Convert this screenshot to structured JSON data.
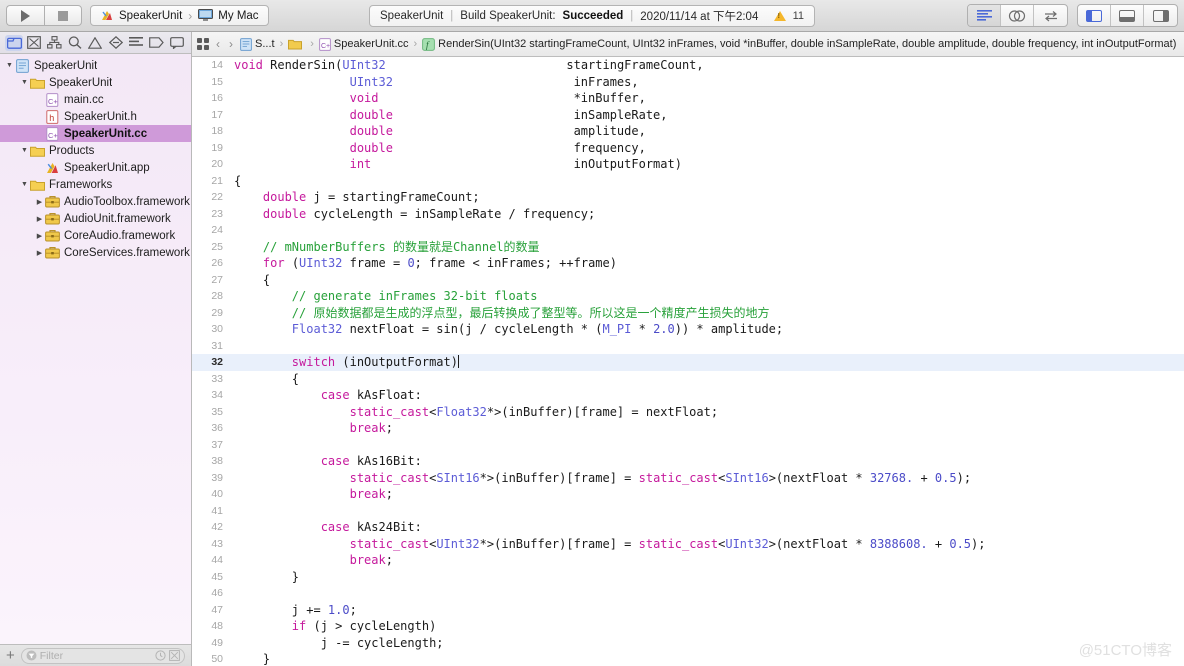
{
  "window": {
    "title": "SpeakerUnit",
    "watermark": "@51CTO博客"
  },
  "toolbar": {
    "run_button": "Run",
    "stop_button": "Stop",
    "scheme": {
      "target": "SpeakerUnit",
      "separator": "›",
      "destination": "My Mac"
    },
    "status": {
      "project": "SpeakerUnit",
      "sep1": "|",
      "action": "Build SpeakerUnit:",
      "result": "Succeeded",
      "sep2": "|",
      "timestamp": "2020/11/14 at 下午2:04",
      "warning_count": "11"
    },
    "editor_modes": [
      {
        "name": "standard-editor",
        "icon": "lines-icon",
        "active": true
      },
      {
        "name": "assistant-editor",
        "icon": "venn-icon",
        "active": false
      },
      {
        "name": "version-editor",
        "icon": "swap-arrows-icon",
        "active": false
      }
    ],
    "panel_toggles": [
      {
        "name": "navigator-toggle",
        "icon": "panel-left-icon",
        "active": true
      },
      {
        "name": "debug-area-toggle",
        "icon": "panel-bottom-icon",
        "active": false
      },
      {
        "name": "utilities-toggle",
        "icon": "panel-right-icon",
        "active": false
      }
    ]
  },
  "navigator": {
    "tabs": [
      {
        "name": "project-navigator",
        "icon": "folder-icon",
        "selected": true
      },
      {
        "name": "source-control-navigator",
        "icon": "source-control-icon",
        "selected": false
      },
      {
        "name": "symbol-navigator",
        "icon": "hierarchy-icon",
        "selected": false
      },
      {
        "name": "find-navigator",
        "icon": "search-icon",
        "selected": false
      },
      {
        "name": "issue-navigator",
        "icon": "warning-triangle-icon",
        "selected": false
      },
      {
        "name": "test-navigator",
        "icon": "diamond-icon",
        "selected": false
      },
      {
        "name": "debug-navigator",
        "icon": "debug-gauge-icon",
        "selected": false
      },
      {
        "name": "breakpoint-navigator",
        "icon": "breakpoint-tag-icon",
        "selected": false
      },
      {
        "name": "report-navigator",
        "icon": "speech-bubble-icon",
        "selected": false
      }
    ],
    "tree": [
      {
        "label": "SpeakerUnit",
        "depth": 0,
        "icon": "project-icon",
        "disclosure": "open",
        "selected": false
      },
      {
        "label": "SpeakerUnit",
        "depth": 1,
        "icon": "folder-icon",
        "disclosure": "open",
        "selected": false
      },
      {
        "label": "main.cc",
        "depth": 2,
        "icon": "cc-file-icon",
        "disclosure": "none",
        "selected": false
      },
      {
        "label": "SpeakerUnit.h",
        "depth": 2,
        "icon": "h-file-icon",
        "disclosure": "none",
        "selected": false
      },
      {
        "label": "SpeakerUnit.cc",
        "depth": 2,
        "icon": "cc-file-icon",
        "disclosure": "none",
        "selected": true
      },
      {
        "label": "Products",
        "depth": 1,
        "icon": "folder-icon",
        "disclosure": "open",
        "selected": false
      },
      {
        "label": "SpeakerUnit.app",
        "depth": 2,
        "icon": "app-icon",
        "disclosure": "none",
        "selected": false
      },
      {
        "label": "Frameworks",
        "depth": 1,
        "icon": "folder-icon",
        "disclosure": "open",
        "selected": false
      },
      {
        "label": "AudioToolbox.framework",
        "depth": 2,
        "icon": "framework-icon",
        "disclosure": "closed",
        "selected": false
      },
      {
        "label": "AudioUnit.framework",
        "depth": 2,
        "icon": "framework-icon",
        "disclosure": "closed",
        "selected": false
      },
      {
        "label": "CoreAudio.framework",
        "depth": 2,
        "icon": "framework-icon",
        "disclosure": "closed",
        "selected": false
      },
      {
        "label": "CoreServices.framework",
        "depth": 2,
        "icon": "framework-icon",
        "disclosure": "closed",
        "selected": false
      }
    ],
    "filter": {
      "add_label": "+",
      "placeholder": "Filter",
      "recent_icon": "clock-icon",
      "sourcecontrol_icon": "source-control-filter-icon"
    }
  },
  "jumpbar": {
    "related_items": "related-items-icon",
    "back": "‹",
    "forward": "›",
    "crumbs": [
      {
        "label": "S...t",
        "icon": "project-icon"
      },
      {
        "label": "",
        "icon": "folder-icon"
      },
      {
        "label": "SpeakerUnit.cc",
        "icon": "cc-file-icon"
      },
      {
        "label": "RenderSin(UInt32 startingFrameCount, UInt32 inFrames, void *inBuffer, double inSampleRate, double amplitude, double frequency, int inOutputFormat)",
        "icon": "function-icon"
      }
    ],
    "prev_issue": "‹",
    "next_issue": "›",
    "issue_icon": "warning-triangle-icon"
  },
  "code": {
    "current_line": 32,
    "lines": [
      {
        "n": 14,
        "tokens": [
          {
            "t": "void",
            "c": "kw"
          },
          {
            "t": " RenderSin(",
            "c": "plain"
          },
          {
            "t": "UInt32",
            "c": "typ"
          },
          {
            "t": "                         startingFrameCount,",
            "c": "plain"
          }
        ]
      },
      {
        "n": 15,
        "tokens": [
          {
            "t": "                ",
            "c": "plain"
          },
          {
            "t": "UInt32",
            "c": "typ"
          },
          {
            "t": "                         inFrames,",
            "c": "plain"
          }
        ]
      },
      {
        "n": 16,
        "tokens": [
          {
            "t": "                ",
            "c": "plain"
          },
          {
            "t": "void",
            "c": "kw"
          },
          {
            "t": "                           *inBuffer,",
            "c": "plain"
          }
        ]
      },
      {
        "n": 17,
        "tokens": [
          {
            "t": "                ",
            "c": "plain"
          },
          {
            "t": "double",
            "c": "kw"
          },
          {
            "t": "                         inSampleRate,",
            "c": "plain"
          }
        ]
      },
      {
        "n": 18,
        "tokens": [
          {
            "t": "                ",
            "c": "plain"
          },
          {
            "t": "double",
            "c": "kw"
          },
          {
            "t": "                         amplitude,",
            "c": "plain"
          }
        ]
      },
      {
        "n": 19,
        "tokens": [
          {
            "t": "                ",
            "c": "plain"
          },
          {
            "t": "double",
            "c": "kw"
          },
          {
            "t": "                         frequency,",
            "c": "plain"
          }
        ]
      },
      {
        "n": 20,
        "tokens": [
          {
            "t": "                ",
            "c": "plain"
          },
          {
            "t": "int",
            "c": "kw"
          },
          {
            "t": "                            inOutputFormat)",
            "c": "plain"
          }
        ]
      },
      {
        "n": 21,
        "tokens": [
          {
            "t": "{",
            "c": "plain"
          }
        ]
      },
      {
        "n": 22,
        "tokens": [
          {
            "t": "    ",
            "c": "plain"
          },
          {
            "t": "double",
            "c": "kw"
          },
          {
            "t": " j = startingFrameCount;",
            "c": "plain"
          }
        ]
      },
      {
        "n": 23,
        "tokens": [
          {
            "t": "    ",
            "c": "plain"
          },
          {
            "t": "double",
            "c": "kw"
          },
          {
            "t": " cycleLength = inSampleRate / frequency;",
            "c": "plain"
          }
        ]
      },
      {
        "n": 24,
        "tokens": []
      },
      {
        "n": 25,
        "tokens": [
          {
            "t": "    ",
            "c": "plain"
          },
          {
            "t": "// mNumberBuffers 的数量就是Channel的数量",
            "c": "cmt"
          }
        ]
      },
      {
        "n": 26,
        "tokens": [
          {
            "t": "    ",
            "c": "plain"
          },
          {
            "t": "for",
            "c": "kw"
          },
          {
            "t": " (",
            "c": "plain"
          },
          {
            "t": "UInt32",
            "c": "typ"
          },
          {
            "t": " frame = ",
            "c": "plain"
          },
          {
            "t": "0",
            "c": "num"
          },
          {
            "t": "; frame < inFrames; ++frame)",
            "c": "plain"
          }
        ]
      },
      {
        "n": 27,
        "tokens": [
          {
            "t": "    {",
            "c": "plain"
          }
        ]
      },
      {
        "n": 28,
        "tokens": [
          {
            "t": "        ",
            "c": "plain"
          },
          {
            "t": "// generate inFrames 32-bit floats",
            "c": "cmt"
          }
        ]
      },
      {
        "n": 29,
        "tokens": [
          {
            "t": "        ",
            "c": "plain"
          },
          {
            "t": "// 原始数据都是生成的浮点型，最后转换成了整型等。所以这是一个精度产生损失的地方",
            "c": "cmt"
          }
        ]
      },
      {
        "n": 30,
        "tokens": [
          {
            "t": "        ",
            "c": "plain"
          },
          {
            "t": "Float32",
            "c": "typ"
          },
          {
            "t": " nextFloat = sin(j / cycleLength * (",
            "c": "plain"
          },
          {
            "t": "M_PI",
            "c": "mac"
          },
          {
            "t": " * ",
            "c": "plain"
          },
          {
            "t": "2.0",
            "c": "num"
          },
          {
            "t": ")) * amplitude;",
            "c": "plain"
          }
        ]
      },
      {
        "n": 31,
        "tokens": []
      },
      {
        "n": 32,
        "tokens": [
          {
            "t": "        ",
            "c": "plain"
          },
          {
            "t": "switch",
            "c": "kw"
          },
          {
            "t": " (inOutputFormat)",
            "c": "plain"
          }
        ],
        "caret": true
      },
      {
        "n": 33,
        "tokens": [
          {
            "t": "        {",
            "c": "plain"
          }
        ]
      },
      {
        "n": 34,
        "tokens": [
          {
            "t": "            ",
            "c": "plain"
          },
          {
            "t": "case",
            "c": "kw"
          },
          {
            "t": " kAsFloat:",
            "c": "plain"
          }
        ]
      },
      {
        "n": 35,
        "tokens": [
          {
            "t": "                ",
            "c": "plain"
          },
          {
            "t": "static_cast",
            "c": "kw"
          },
          {
            "t": "<",
            "c": "plain"
          },
          {
            "t": "Float32",
            "c": "typ"
          },
          {
            "t": "*>(inBuffer)[frame] = nextFloat;",
            "c": "plain"
          }
        ]
      },
      {
        "n": 36,
        "tokens": [
          {
            "t": "                ",
            "c": "plain"
          },
          {
            "t": "break",
            "c": "kw"
          },
          {
            "t": ";",
            "c": "plain"
          }
        ]
      },
      {
        "n": 37,
        "tokens": []
      },
      {
        "n": 38,
        "tokens": [
          {
            "t": "            ",
            "c": "plain"
          },
          {
            "t": "case",
            "c": "kw"
          },
          {
            "t": " kAs16Bit:",
            "c": "plain"
          }
        ]
      },
      {
        "n": 39,
        "tokens": [
          {
            "t": "                ",
            "c": "plain"
          },
          {
            "t": "static_cast",
            "c": "kw"
          },
          {
            "t": "<",
            "c": "plain"
          },
          {
            "t": "SInt16",
            "c": "typ"
          },
          {
            "t": "*>(inBuffer)[frame] = ",
            "c": "plain"
          },
          {
            "t": "static_cast",
            "c": "kw"
          },
          {
            "t": "<",
            "c": "plain"
          },
          {
            "t": "SInt16",
            "c": "typ"
          },
          {
            "t": ">(nextFloat * ",
            "c": "plain"
          },
          {
            "t": "32768.",
            "c": "num"
          },
          {
            "t": " + ",
            "c": "plain"
          },
          {
            "t": "0.5",
            "c": "num"
          },
          {
            "t": ");",
            "c": "plain"
          }
        ]
      },
      {
        "n": 40,
        "tokens": [
          {
            "t": "                ",
            "c": "plain"
          },
          {
            "t": "break",
            "c": "kw"
          },
          {
            "t": ";",
            "c": "plain"
          }
        ]
      },
      {
        "n": 41,
        "tokens": []
      },
      {
        "n": 42,
        "tokens": [
          {
            "t": "            ",
            "c": "plain"
          },
          {
            "t": "case",
            "c": "kw"
          },
          {
            "t": " kAs24Bit:",
            "c": "plain"
          }
        ]
      },
      {
        "n": 43,
        "tokens": [
          {
            "t": "                ",
            "c": "plain"
          },
          {
            "t": "static_cast",
            "c": "kw"
          },
          {
            "t": "<",
            "c": "plain"
          },
          {
            "t": "UInt32",
            "c": "typ"
          },
          {
            "t": "*>(inBuffer)[frame] = ",
            "c": "plain"
          },
          {
            "t": "static_cast",
            "c": "kw"
          },
          {
            "t": "<",
            "c": "plain"
          },
          {
            "t": "UInt32",
            "c": "typ"
          },
          {
            "t": ">(nextFloat * ",
            "c": "plain"
          },
          {
            "t": "8388608.",
            "c": "num"
          },
          {
            "t": " + ",
            "c": "plain"
          },
          {
            "t": "0.5",
            "c": "num"
          },
          {
            "t": ");",
            "c": "plain"
          }
        ]
      },
      {
        "n": 44,
        "tokens": [
          {
            "t": "                ",
            "c": "plain"
          },
          {
            "t": "break",
            "c": "kw"
          },
          {
            "t": ";",
            "c": "plain"
          }
        ]
      },
      {
        "n": 45,
        "tokens": [
          {
            "t": "        }",
            "c": "plain"
          }
        ]
      },
      {
        "n": 46,
        "tokens": []
      },
      {
        "n": 47,
        "tokens": [
          {
            "t": "        j += ",
            "c": "plain"
          },
          {
            "t": "1.0",
            "c": "num"
          },
          {
            "t": ";",
            "c": "plain"
          }
        ]
      },
      {
        "n": 48,
        "tokens": [
          {
            "t": "        ",
            "c": "plain"
          },
          {
            "t": "if",
            "c": "kw"
          },
          {
            "t": " (j > cycleLength)",
            "c": "plain"
          }
        ]
      },
      {
        "n": 49,
        "tokens": [
          {
            "t": "            j -= cycleLength;",
            "c": "plain"
          }
        ]
      },
      {
        "n": 50,
        "tokens": [
          {
            "t": "    }",
            "c": "plain"
          }
        ]
      }
    ]
  },
  "colors": {
    "accent": "#4a69d8",
    "selection": "#cf9ad9",
    "current_line": "#e9f0fb",
    "keyword": "#c5199c",
    "type": "#5c5cd6",
    "number": "#4b4bc8",
    "comment": "#28a13a",
    "warning": "#f5b72b"
  }
}
